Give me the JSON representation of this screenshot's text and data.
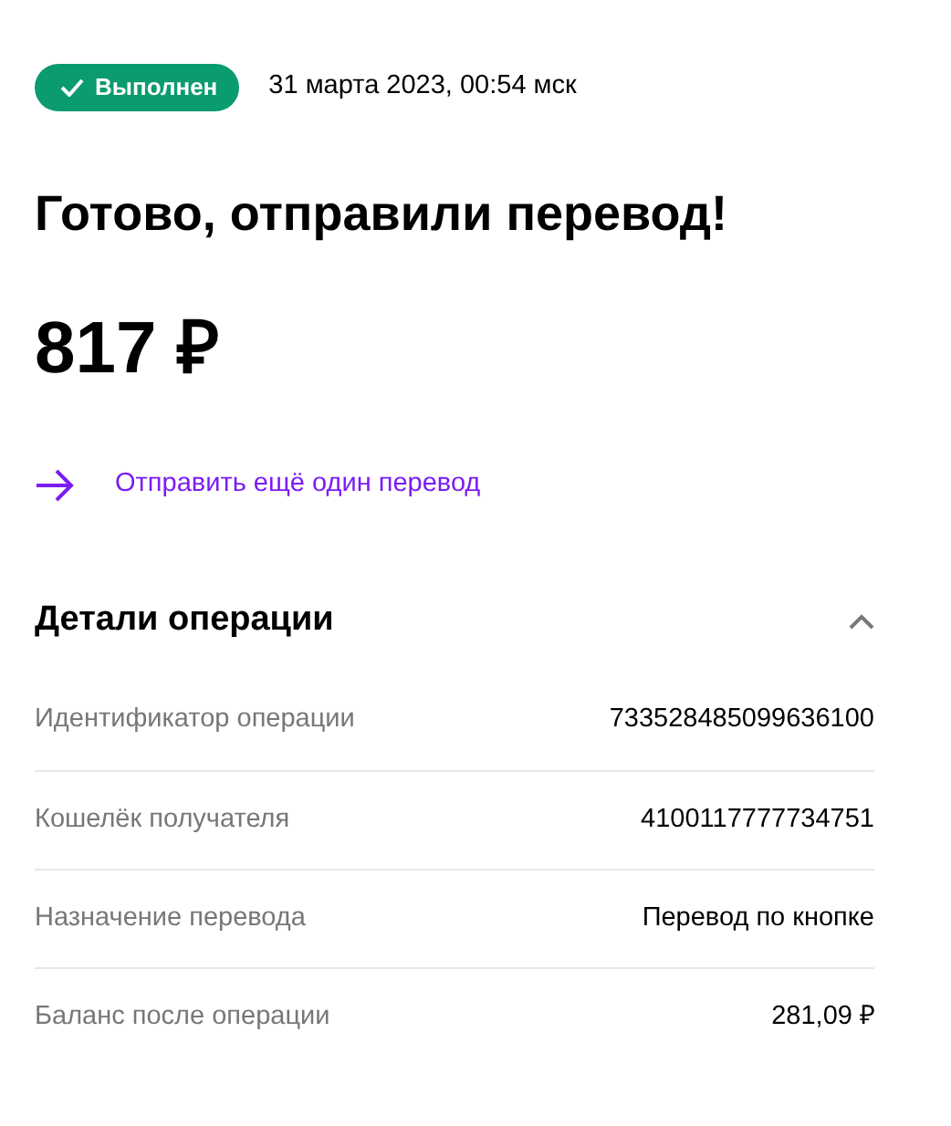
{
  "status": {
    "label": "Выполнен",
    "kind": "success"
  },
  "timestamp": "31 марта 2023, 00:54 мск",
  "title": "Готово, отправили перевод!",
  "amount": "817 ₽",
  "action_link": "Отправить ещё один перевод",
  "details": {
    "title": "Детали операции",
    "expanded": true,
    "rows": [
      {
        "label": "Идентификатор операции",
        "value": "733528485099636100"
      },
      {
        "label": "Кошелёк получателя",
        "value": "4100117777734751"
      },
      {
        "label": "Назначение перевода",
        "value": "Перевод по кнопке"
      },
      {
        "label": "Баланс после операции",
        "value": "281,09 ₽"
      }
    ]
  }
}
